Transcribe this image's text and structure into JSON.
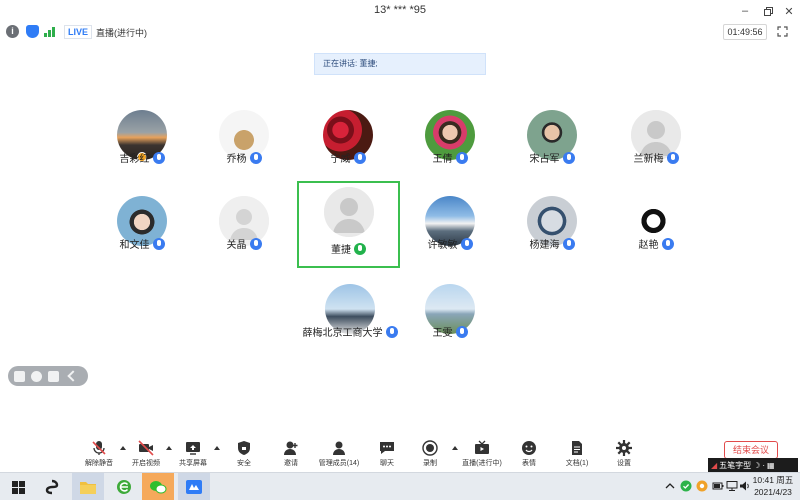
{
  "window": {
    "title": "13* *** *95"
  },
  "infobar": {
    "live_badge": "LIVE",
    "status": "直播(进行中)",
    "timer": "01:49:56"
  },
  "speaking": {
    "prefix": "正在讲话: ",
    "name": "董捷;"
  },
  "participants": [
    {
      "name": "吉彩红",
      "host": true
    },
    {
      "name": "乔杨"
    },
    {
      "name": "宁威"
    },
    {
      "name": "王倩"
    },
    {
      "name": "宋占军"
    },
    {
      "name": "兰新梅"
    },
    {
      "name": "和文佳"
    },
    {
      "name": "关晶"
    },
    {
      "name": "董捷",
      "speaking": true
    },
    {
      "name": "许敏敏"
    },
    {
      "name": "杨建海"
    },
    {
      "name": "赵艳"
    },
    {
      "name": "薛梅北京工商大学"
    },
    {
      "name": "王雯"
    }
  ],
  "toolbar": {
    "unmute": "解除静音",
    "start_video": "开启视频",
    "share_screen": "共享屏幕",
    "security": "安全",
    "invite": "邀请",
    "manage_members": "管理成员(14)",
    "chat": "聊天",
    "record": "录制",
    "live": "直播(进行中)",
    "reactions": "表情",
    "documents": "文档(1)",
    "settings": "设置",
    "end_meeting": "结束会议"
  },
  "ime": {
    "label": "五笔字型"
  },
  "taskbar": {
    "time": "10:41 周五",
    "date": "2021/4/23"
  },
  "colors": {
    "accent": "#2f7cf6",
    "speaking_border": "#3bbf4f",
    "end_red": "#e14b4b"
  }
}
